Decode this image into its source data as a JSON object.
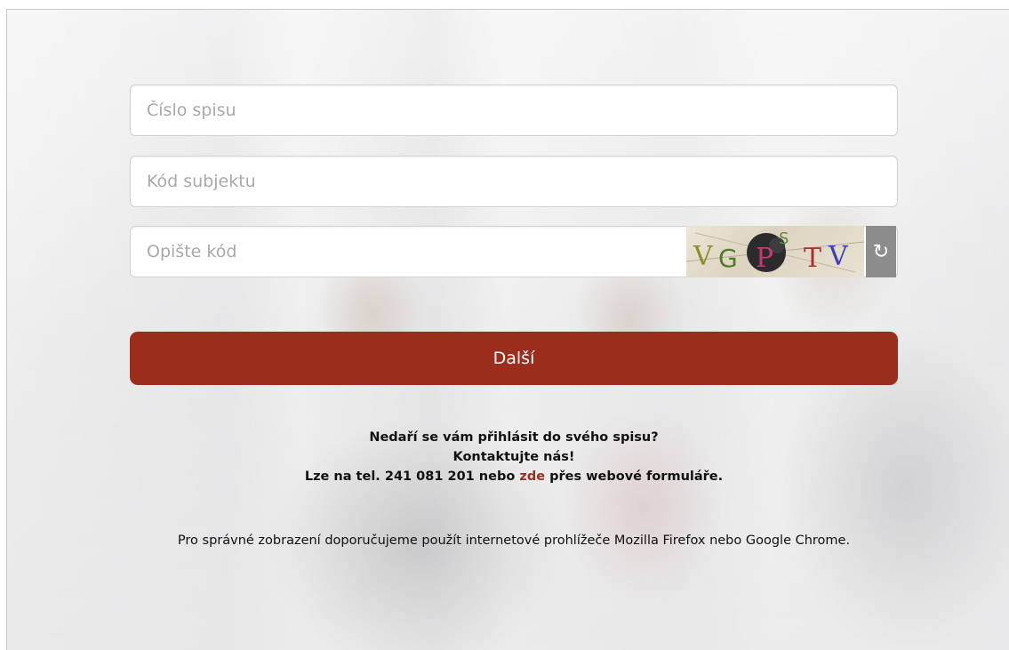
{
  "form": {
    "case_number_placeholder": "Číslo spisu",
    "subject_code_placeholder": "Kód subjektu",
    "captcha_placeholder": "Opište kód",
    "captcha_text": "VG P TV",
    "refresh_icon": "↻",
    "next_label": "Další"
  },
  "help": {
    "line1": "Nedaří se vám přihlásit do svého spisu?",
    "line2": "Kontaktujte nás!",
    "line3_prefix": "Lze na tel. 241 081 201 nebo",
    "line3_link": "zde",
    "line3_suffix": "přes webové formuláře."
  },
  "browser_note": "Pro správné zobrazení doporučujeme použít internetové prohlížeče Mozilla Firefox nebo Google Chrome.",
  "colors": {
    "accent": "#9b2d1d",
    "refresh_bg": "#8d8d8d"
  },
  "icons": {
    "refresh": "refresh-icon"
  }
}
